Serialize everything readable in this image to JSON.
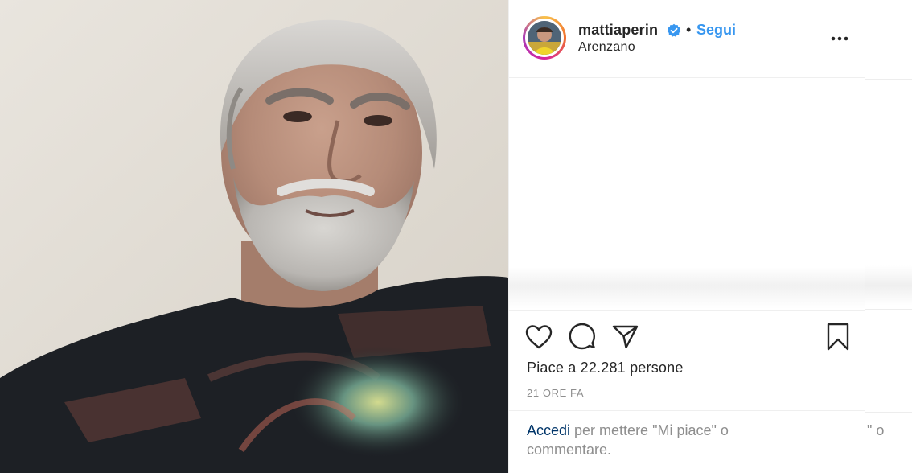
{
  "post": {
    "username": "mattiaperin",
    "separator": "•",
    "follow_label": "Segui",
    "location": "Arenzano",
    "more_icon": "more-horizontal-icon",
    "likes_text": "Piace a 22.281 persone",
    "timestamp": "21 ORE FA"
  },
  "login": {
    "link_label": "Accedi",
    "text": " per mettere \"Mi piace\" o commentare."
  },
  "edge": {
    "text": "\" o"
  },
  "icons": {
    "like": "heart-icon",
    "comment": "comment-icon",
    "share": "share-icon",
    "save": "bookmark-icon",
    "verified": "verified-badge-icon"
  },
  "colors": {
    "accent": "#3897f0",
    "link": "#003569",
    "text": "#262626",
    "muted": "#8e8e8e",
    "border": "#efefef"
  }
}
